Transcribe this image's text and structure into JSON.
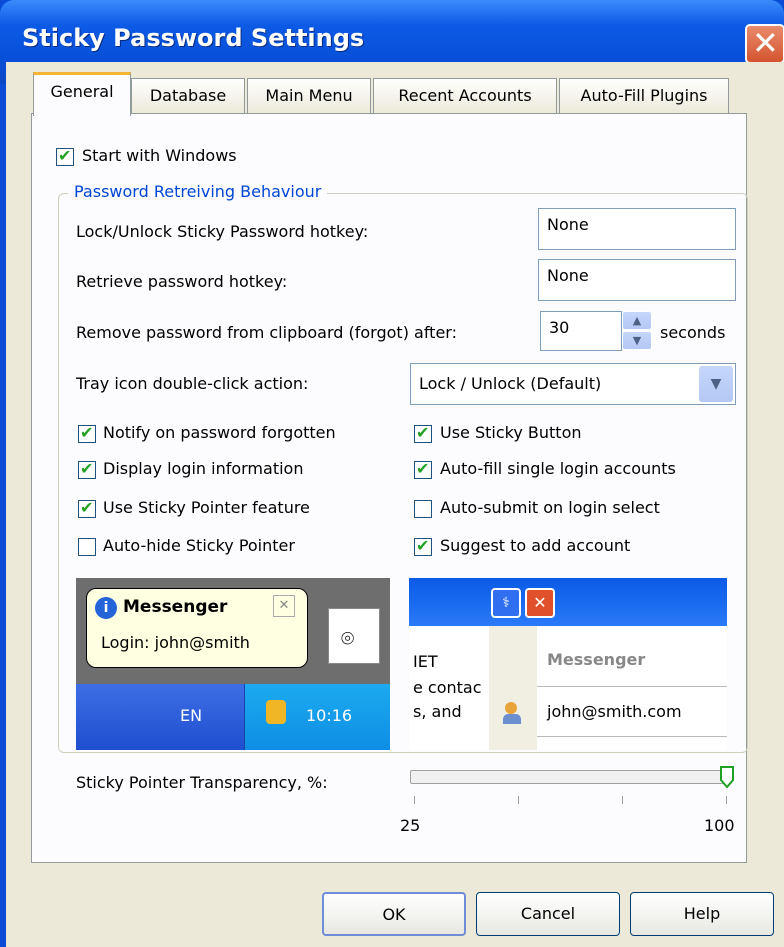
{
  "window": {
    "title": "Sticky Password Settings",
    "close_glyph": "✕"
  },
  "tabs": [
    {
      "label": "General",
      "active": true
    },
    {
      "label": "Database",
      "active": false
    },
    {
      "label": "Main Menu",
      "active": false
    },
    {
      "label": "Recent Accounts",
      "active": false
    },
    {
      "label": "Auto-Fill Plugins",
      "active": false
    }
  ],
  "general": {
    "start_with_windows": {
      "label": "Start with Windows",
      "checked": true
    },
    "group_title": "Password Retreiving Behaviour",
    "lock_hotkey": {
      "label": "Lock/Unlock Sticky Password hotkey:",
      "value": "None"
    },
    "retrieve_hotkey": {
      "label": "Retrieve password hotkey:",
      "value": "None"
    },
    "clipboard": {
      "label": "Remove password from clipboard (forgot) after:",
      "value": "30",
      "unit": "seconds"
    },
    "tray_action": {
      "label": "Tray icon double-click action:",
      "value": "Lock / Unlock (Default)"
    },
    "options_left": [
      {
        "label": "Notify on password forgotten",
        "checked": true
      },
      {
        "label": "Display login information",
        "checked": true
      },
      {
        "label": "Use Sticky Pointer feature",
        "checked": true
      },
      {
        "label": "Auto-hide Sticky Pointer",
        "checked": false
      }
    ],
    "options_right": [
      {
        "label": "Use Sticky Button",
        "checked": true
      },
      {
        "label": "Auto-fill single login accounts",
        "checked": true
      },
      {
        "label": "Auto-submit on login select",
        "checked": false
      },
      {
        "label": "Suggest to add account",
        "checked": true
      }
    ],
    "preview_left": {
      "balloon_title": "Messenger",
      "balloon_text": "Login: john@smith",
      "tray_lang": "EN",
      "tray_time": "10:16"
    },
    "preview_right": {
      "col_text_1": "IET",
      "col_text_2": "e contac",
      "col_text_3": "s, and",
      "account_name": "Messenger",
      "account_login": "john@smith.com"
    },
    "transparency": {
      "label": "Sticky Pointer Transparency, %:",
      "min": "25",
      "max": "100",
      "value": 100
    }
  },
  "buttons": {
    "ok": "OK",
    "cancel": "Cancel",
    "help": "Help"
  }
}
